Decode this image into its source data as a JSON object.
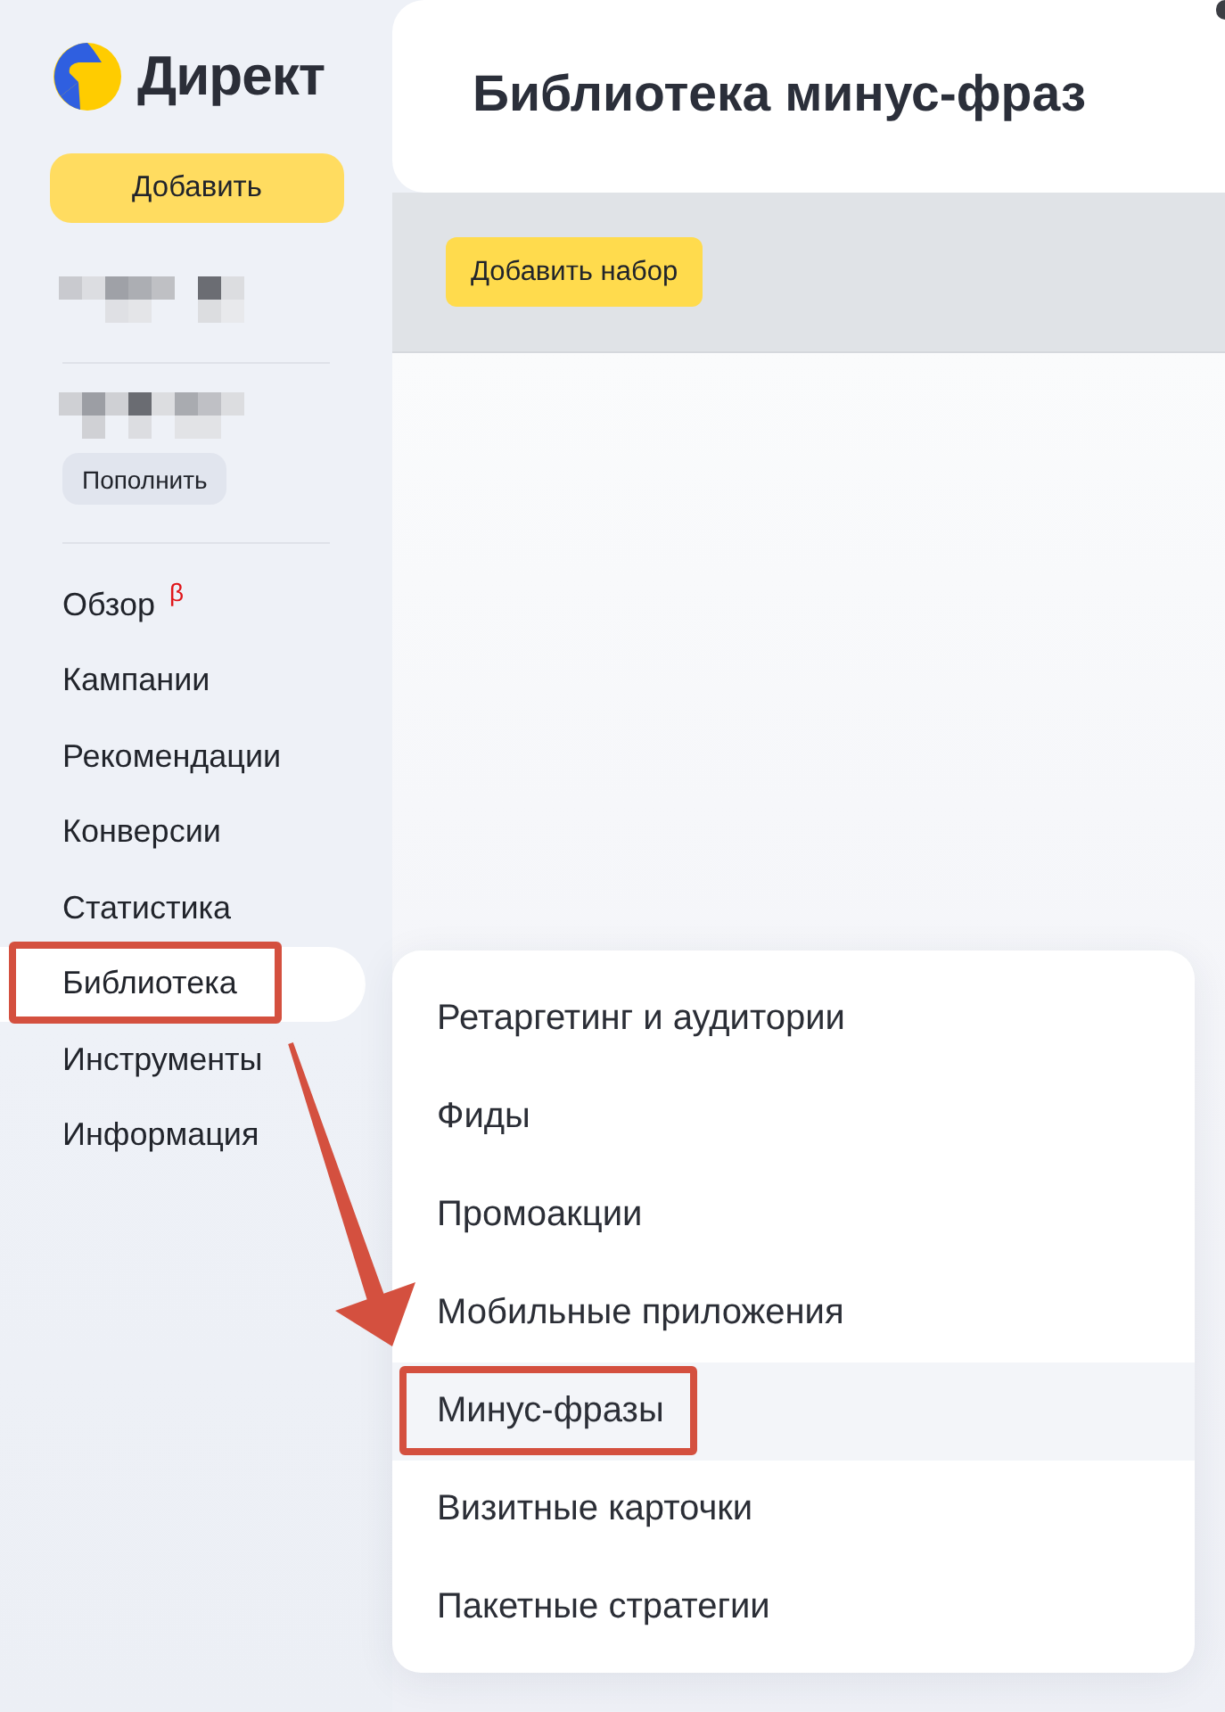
{
  "logo": {
    "text": "Директ"
  },
  "sidebar": {
    "add_button": "Добавить",
    "top_up_button": "Пополнить",
    "nav": [
      {
        "label": "Обзор",
        "badge": "β",
        "selected": false,
        "annotated": false
      },
      {
        "label": "Кампании",
        "selected": false,
        "annotated": false
      },
      {
        "label": "Рекомендации",
        "selected": false,
        "annotated": false
      },
      {
        "label": "Конверсии",
        "selected": false,
        "annotated": false
      },
      {
        "label": "Статистика",
        "selected": false,
        "annotated": false
      },
      {
        "label": "Библиотека",
        "selected": true,
        "annotated": true
      },
      {
        "label": "Инструменты",
        "selected": false,
        "annotated": false
      },
      {
        "label": "Информация",
        "selected": false,
        "annotated": false
      }
    ]
  },
  "header": {
    "title": "Библиотека минус-фраз"
  },
  "toolbar": {
    "add_set_button": "Добавить набор"
  },
  "library_menu": {
    "items": [
      {
        "label": "Ретаргетинг и аудитории",
        "selected": false,
        "annotated": false
      },
      {
        "label": "Фиды",
        "selected": false,
        "annotated": false
      },
      {
        "label": "Промоакции",
        "selected": false,
        "annotated": false
      },
      {
        "label": "Мобильные приложения",
        "selected": false,
        "annotated": false
      },
      {
        "label": "Минус-фразы",
        "selected": true,
        "annotated": true
      },
      {
        "label": "Визитные карточки",
        "selected": false,
        "annotated": false
      },
      {
        "label": "Пакетные стратегии",
        "selected": false,
        "annotated": false
      }
    ]
  }
}
